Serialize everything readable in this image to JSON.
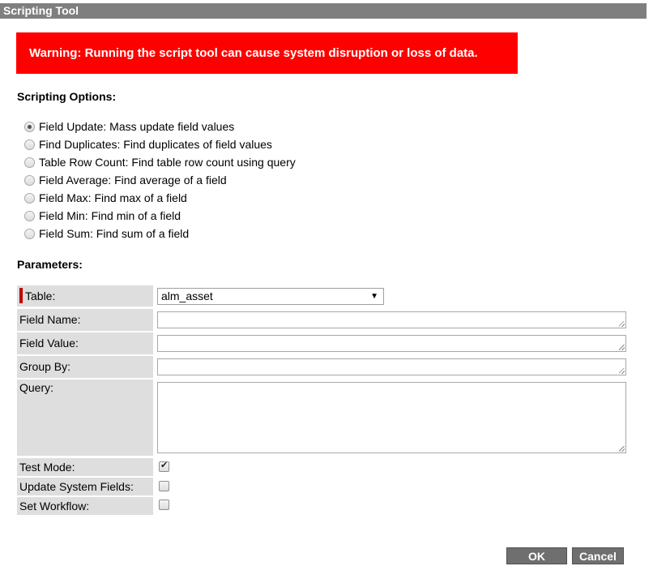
{
  "window": {
    "title": "Scripting Tool"
  },
  "warning": {
    "text": "Warning: Running the script tool can cause system disruption or loss of data."
  },
  "scripting_options": {
    "heading": "Scripting Options:",
    "selected_index": 0,
    "options": [
      {
        "label": "Field Update: Mass update field values",
        "selected": true
      },
      {
        "label": "Find Duplicates: Find duplicates of field values",
        "selected": false
      },
      {
        "label": "Table Row Count: Find table row count using query",
        "selected": false
      },
      {
        "label": "Field Average: Find average of a field",
        "selected": false
      },
      {
        "label": "Field Max: Find max of a field",
        "selected": false
      },
      {
        "label": "Field Min: Find min of a field",
        "selected": false
      },
      {
        "label": "Field Sum: Find sum of a field",
        "selected": false
      }
    ]
  },
  "parameters": {
    "heading": "Parameters:",
    "table": {
      "label": "Table:",
      "value": "alm_asset",
      "mandatory": true
    },
    "field_name": {
      "label": "Field Name:",
      "value": ""
    },
    "field_value": {
      "label": "Field Value:",
      "value": ""
    },
    "group_by": {
      "label": "Group By:",
      "value": ""
    },
    "query": {
      "label": "Query:",
      "value": ""
    },
    "test_mode": {
      "label": "Test Mode:",
      "checked": true
    },
    "update_system_fields": {
      "label": "Update System Fields:",
      "checked": false
    },
    "set_workflow": {
      "label": "Set Workflow:",
      "checked": false
    }
  },
  "buttons": {
    "ok": "OK",
    "cancel": "Cancel"
  },
  "colors": {
    "warning_bg": "#ff0000",
    "titlebar_bg": "#7f7f7f",
    "mandatory_marker": "#c00000",
    "label_bg": "#dedede",
    "button_bg": "#6f6f6f"
  }
}
